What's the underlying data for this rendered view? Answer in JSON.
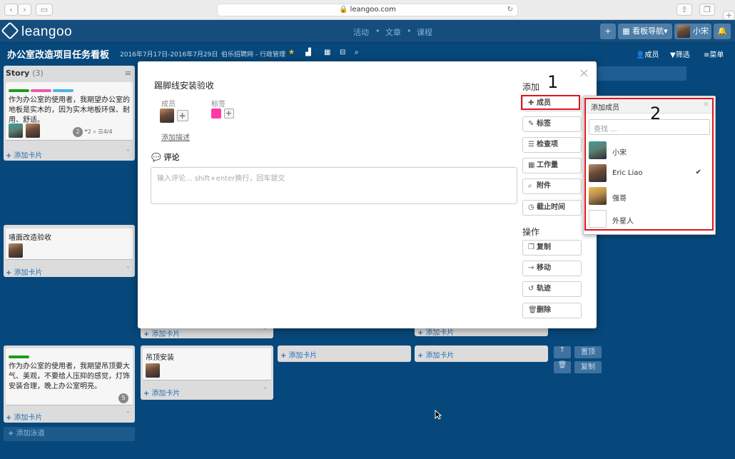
{
  "browser": {
    "url": "leangoo.com",
    "lock": "🔒",
    "back": "‹",
    "forward": "›",
    "reload": "↻"
  },
  "app": {
    "logo": "leangoo",
    "nav": [
      "活动",
      "文章",
      "课程"
    ],
    "nav_sep": "•",
    "add": "+",
    "board_nav": "看板导航",
    "caret": "▾",
    "user": "小宋",
    "bell": "♪"
  },
  "board": {
    "title": "办公室改造项目任务看板",
    "dates": "2016年7月17日-2016年7月29日",
    "owner": "伯乐招聘网 - 行政管理",
    "star": "★",
    "members_btn": "成员",
    "filter_btn": "筛选",
    "menu_btn": "菜单"
  },
  "lists": {
    "story": {
      "title": "Story",
      "count": "(3)"
    },
    "add_card": "添加卡片",
    "plus": "+",
    "collapse": "⌃",
    "add_lane": "添加泳道",
    "card1": {
      "text": "作为办公室的使用者，我期望办公室的地板是实木的，因为实木地板环保、耐用、舒适。",
      "badge": "2",
      "comments": "2",
      "checklist": "4/4"
    },
    "card2": {
      "text": "墙面改造验收"
    },
    "card3": {
      "text": "作为办公室的使用者，我期望吊顶要大气、美观，不要给人压抑的感觉，灯饰安装合理，晚上办公室明亮。",
      "badge": "5"
    },
    "card4": {
      "text": "吊顶安装"
    },
    "lane_top": "置顶",
    "lane_copy": "复制",
    "up_icon": "↑",
    "trash_icon": "🗑"
  },
  "modal": {
    "title": "踢脚线安装验收",
    "members_label": "成员",
    "labels_label": "标签",
    "add_desc": "添加描述",
    "comment_title": "评论",
    "comment_placeholder": "输入评论... shift+enter换行，回车提交",
    "close": "×",
    "add_section": "添加",
    "add_buttons": [
      {
        "label": "成员",
        "icon": "✚"
      },
      {
        "label": "标签",
        "icon": "✎"
      },
      {
        "label": "检查项",
        "icon": "☰"
      },
      {
        "label": "工作量",
        "icon": "▦"
      },
      {
        "label": "附件",
        "icon": "⌕"
      },
      {
        "label": "截止时间",
        "icon": "◷"
      }
    ],
    "ops_section": "操作",
    "op_buttons": [
      {
        "label": "复制",
        "icon": "❐"
      },
      {
        "label": "移动",
        "icon": "→"
      },
      {
        "label": "轨迹",
        "icon": "↺"
      },
      {
        "label": "删除",
        "icon": "🗑"
      }
    ],
    "label_color": "#ff3aa7"
  },
  "popup": {
    "title": "添加成员",
    "close": "×",
    "search_placeholder": "查找 ...",
    "members": [
      {
        "name": "小宋",
        "selected": false
      },
      {
        "name": "Eric Liao",
        "selected": true
      },
      {
        "name": "强哥",
        "selected": false
      },
      {
        "name": "外星人",
        "selected": false
      }
    ],
    "check": "✔"
  },
  "annotations": {
    "one": "1",
    "two": "2"
  }
}
